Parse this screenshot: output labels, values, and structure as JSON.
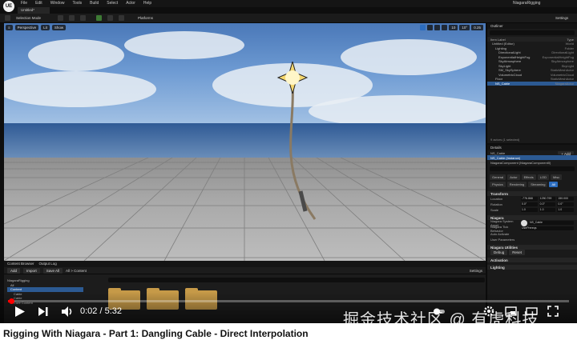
{
  "editor": {
    "app_badge": "UE",
    "menu": [
      "File",
      "Edit",
      "Window",
      "Tools",
      "Build",
      "Select",
      "Actor",
      "Help"
    ],
    "project_name": "NiagaraRigging",
    "level_tab": "Untitled*",
    "toolbar": {
      "selection_mode": "Selection Mode",
      "platforms": "Platforms",
      "settings": "Settings"
    },
    "viewport": {
      "perspective": "Perspective",
      "lit": "Lit",
      "show": "Show",
      "snap_values": [
        "10",
        "10°",
        "0.25"
      ]
    },
    "outliner": {
      "title": "Outliner",
      "col_label": "Item Label",
      "col_type": "Type",
      "rows": [
        {
          "label": "Untitled (Editor)",
          "type": "World",
          "selected": false
        },
        {
          "label": "Lighting",
          "type": "Folder",
          "selected": false
        },
        {
          "label": "DirectionalLight",
          "type": "DirectionalLight",
          "selected": false
        },
        {
          "label": "ExponentialHeightFog",
          "type": "ExponentialHeightFog",
          "selected": false
        },
        {
          "label": "SkyAtmosphere",
          "type": "SkyAtmosphere",
          "selected": false
        },
        {
          "label": "SkyLight",
          "type": "SkyLight",
          "selected": false
        },
        {
          "label": "SM_SkySphere",
          "type": "StaticMeshActor",
          "selected": false
        },
        {
          "label": "VolumetricCloud",
          "type": "VolumetricCloud",
          "selected": false
        },
        {
          "label": "Floor",
          "type": "StaticMeshActor",
          "selected": false
        },
        {
          "label": "NS_Cable",
          "type": "NiagaraActor",
          "selected": true
        }
      ],
      "footer": "9 actors (1 selected)"
    },
    "details": {
      "title": "Details",
      "actor": "NS_Cable",
      "add_label": "+ Add",
      "components": [
        {
          "label": "NS_Cable (Instance)",
          "selected": true
        },
        {
          "label": "NiagaraComponent (NiagaraComponent0)",
          "selected": false
        }
      ],
      "tabs": [
        {
          "label": "General",
          "on": false
        },
        {
          "label": "Actor",
          "on": false
        },
        {
          "label": "Effects",
          "on": false
        },
        {
          "label": "LOD",
          "on": false
        },
        {
          "label": "Misc",
          "on": false
        },
        {
          "label": "Physics",
          "on": false
        },
        {
          "label": "Rendering",
          "on": false
        },
        {
          "label": "Streaming",
          "on": false
        },
        {
          "label": "All",
          "on": true
        }
      ],
      "transform": {
        "header": "Transform",
        "rows": [
          {
            "label": "Location",
            "values": [
              "-776.868",
              "1250.799",
              "150.000"
            ]
          },
          {
            "label": "Rotation",
            "values": [
              "0.0°",
              "0.0°",
              "0.0°"
            ]
          },
          {
            "label": "Scale",
            "values": [
              "1.0",
              "1.0",
              "1.0"
            ]
          }
        ]
      },
      "niagara": {
        "header": "Niagara",
        "asset_label": "Niagara System Asset",
        "asset_value": "NS_Cable",
        "tick_label": "Niagara Tick Behavior",
        "tick_value": "UsePrereqs",
        "auto_activate": "Auto Activate"
      },
      "user_params": "User Parameters",
      "niagara_utilities": "Niagara Utilities",
      "debug_label": "Debug",
      "reset_label": "Reset",
      "activation": "Activation",
      "lighting": "Lighting"
    },
    "content_browser": {
      "tabs": [
        "Content Browser",
        "Output Log"
      ],
      "add_label": "Add",
      "import_label": "Import",
      "save_all_label": "Save All",
      "path": "All > Content",
      "settings": "Settings",
      "tree": [
        {
          "label": "NiagaraRigging",
          "selected": false
        },
        {
          "label": "All",
          "selected": false
        },
        {
          "label": "Content",
          "selected": true
        },
        {
          "label": "Cable",
          "selected": false
        },
        {
          "label": "Cable",
          "selected": false
        },
        {
          "label": "Core Content",
          "selected": false
        }
      ]
    }
  },
  "player": {
    "time_current": "0:02",
    "time_total": "5:32",
    "progress": 0.006,
    "progress_color": "#ff0000"
  },
  "watermark": "掘金技术社区 @ 有虎科技",
  "video_title": "Rigging With Niagara - Part 1: Dangling Cable - Direct Interpolation"
}
